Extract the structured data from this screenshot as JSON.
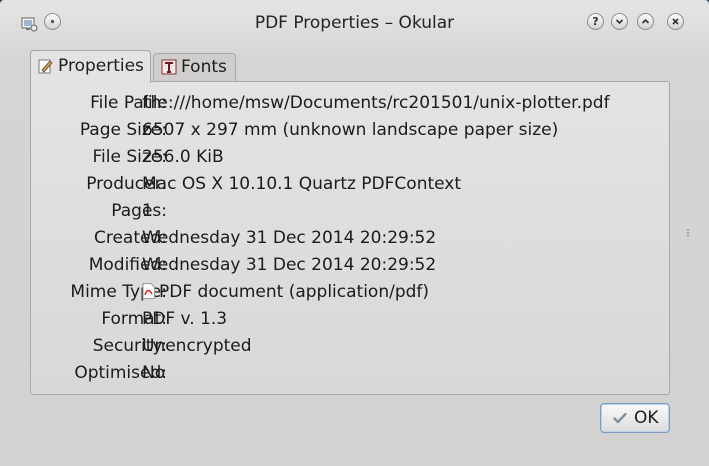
{
  "window": {
    "title": "PDF Properties – Okular",
    "buttons": {
      "help": "?",
      "minimize": "⌄",
      "maximize": "⌃",
      "close": "✕"
    }
  },
  "tabs": [
    {
      "label": "Properties",
      "active": true,
      "icon": "document-edit-icon"
    },
    {
      "label": "Fonts",
      "active": false,
      "icon": "font-icon"
    }
  ],
  "properties": [
    {
      "label": "File Path:",
      "value": "file:///home/msw/Documents/rc201501/unix-plotter.pdf"
    },
    {
      "label": "Page Size:",
      "value": "6507 x 297 mm (unknown landscape paper size)"
    },
    {
      "label": "File Size:",
      "value": "256.0 KiB"
    },
    {
      "label": "Producer:",
      "value": "Mac OS X 10.10.1 Quartz PDFContext"
    },
    {
      "label": "Pages:",
      "value": "1"
    },
    {
      "label": "Created:",
      "value": "Wednesday 31 Dec 2014 20:29:52"
    },
    {
      "label": "Modified:",
      "value": "Wednesday 31 Dec 2014 20:29:52"
    },
    {
      "label": "Mime Type:",
      "value": "PDF document (application/pdf)",
      "icon": "pdf-file-icon"
    },
    {
      "label": "Format:",
      "value": "PDF v. 1.3"
    },
    {
      "label": "Security:",
      "value": "Unencrypted"
    },
    {
      "label": "Optimised:",
      "value": "No"
    }
  ],
  "ok_button": {
    "label": "OK"
  },
  "colors": {
    "accent": "#7a9cc4",
    "background": "#d6d5d3"
  }
}
